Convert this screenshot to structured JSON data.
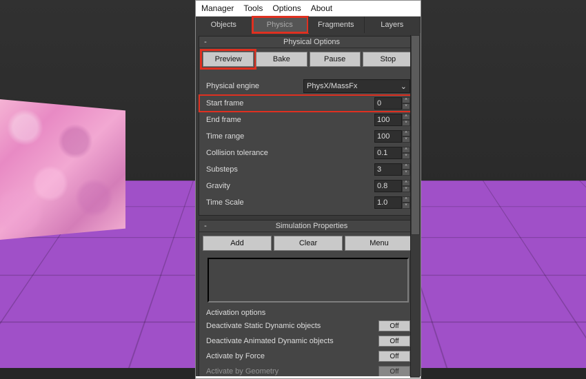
{
  "menu": {
    "items": [
      "Manager",
      "Tools",
      "Options",
      "About"
    ]
  },
  "tabs": [
    "Objects",
    "Physics",
    "Fragments",
    "Layers"
  ],
  "physical_options": {
    "title": "Physical Options",
    "buttons": [
      "Preview",
      "Bake",
      "Pause",
      "Stop"
    ],
    "engine_label": "Physical engine",
    "engine_value": "PhysX/MassFx",
    "params": [
      {
        "label": "Start frame",
        "value": "0"
      },
      {
        "label": "End frame",
        "value": "100"
      },
      {
        "label": "Time range",
        "value": "100"
      },
      {
        "label": "Collision tolerance",
        "value": "0.1"
      },
      {
        "label": "Substeps",
        "value": "3"
      },
      {
        "label": "Gravity",
        "value": "0.8"
      },
      {
        "label": "Time Scale",
        "value": "1.0"
      }
    ]
  },
  "sim_props": {
    "title": "Simulation Properties",
    "buttons": [
      "Add",
      "Clear",
      "Menu"
    ]
  },
  "activation": {
    "title": "Activation options",
    "rows": [
      {
        "label": "Deactivate Static Dynamic objects",
        "value": "Off"
      },
      {
        "label": "Deactivate Animated Dynamic objects",
        "value": "Off"
      },
      {
        "label": "Activate by Force",
        "value": "Off"
      },
      {
        "label": "Activate by Geometry",
        "value": "Off"
      }
    ]
  },
  "glyph": {
    "down": "⌄",
    "up": "˄",
    "sd": "˅"
  }
}
